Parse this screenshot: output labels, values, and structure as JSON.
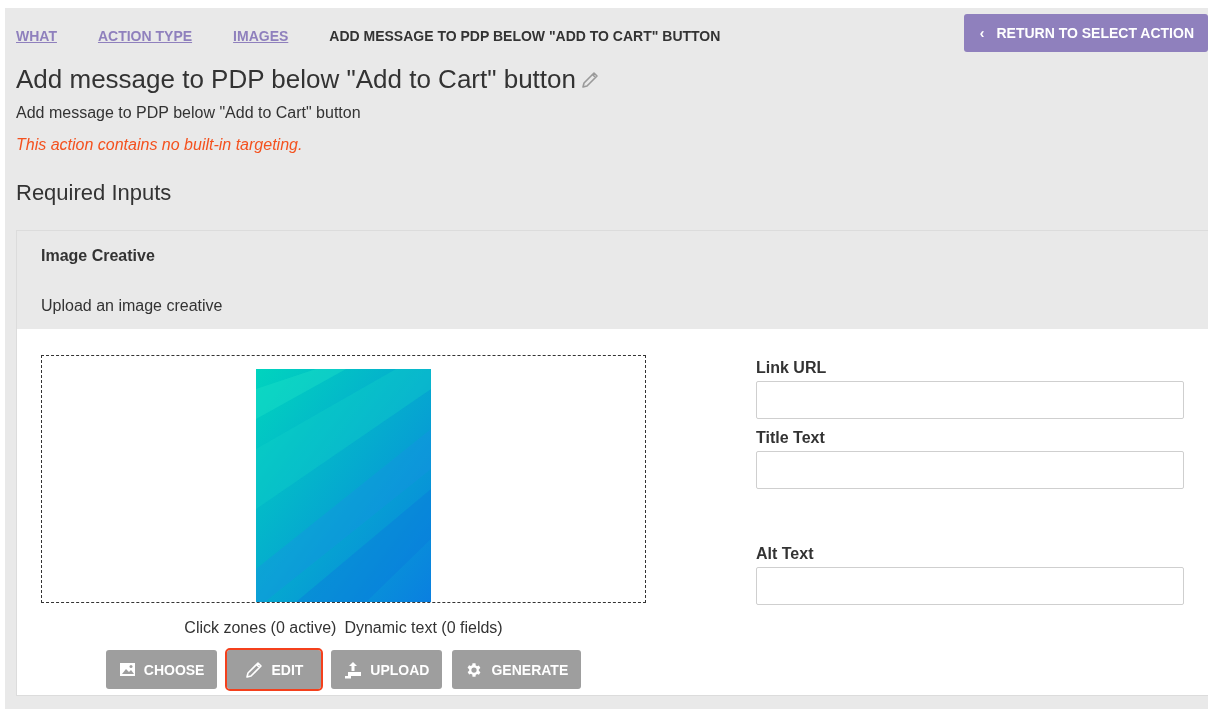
{
  "breadcrumbs": [
    {
      "label": "WHAT",
      "selected": false
    },
    {
      "label": "ACTION TYPE",
      "selected": false
    },
    {
      "label": "IMAGES",
      "selected": false
    },
    {
      "label": "ADD MESSAGE TO PDP BELOW \"ADD TO CART\" BUTTON",
      "selected": true
    }
  ],
  "return_button": {
    "icon": "‹",
    "label": "RETURN TO SELECT ACTION"
  },
  "title": "Add message to PDP below \"Add to Cart\" button",
  "description": "Add message to PDP below \"Add to Cart\" button",
  "warning": "This action contains no built-in targeting.",
  "section_heading": "Required Inputs",
  "panel": {
    "title": "Image Creative",
    "subtitle": "Upload an image creative",
    "preview": {
      "kind": "picture"
    },
    "caption": [
      "Click zones (0 active)",
      "Dynamic text (0 fields)"
    ],
    "buttons": [
      {
        "kind": "choose",
        "label": "CHOOSE",
        "highlighted": false
      },
      {
        "kind": "edit",
        "label": "EDIT",
        "highlighted": true
      },
      {
        "kind": "upload",
        "label": "UPLOAD",
        "highlighted": false
      },
      {
        "kind": "generate",
        "label": "GENERATE",
        "highlighted": false
      }
    ],
    "fields": [
      {
        "label": "Link URL"
      },
      {
        "label": "Title Text"
      },
      {
        "label": "Alt Text"
      }
    ]
  }
}
